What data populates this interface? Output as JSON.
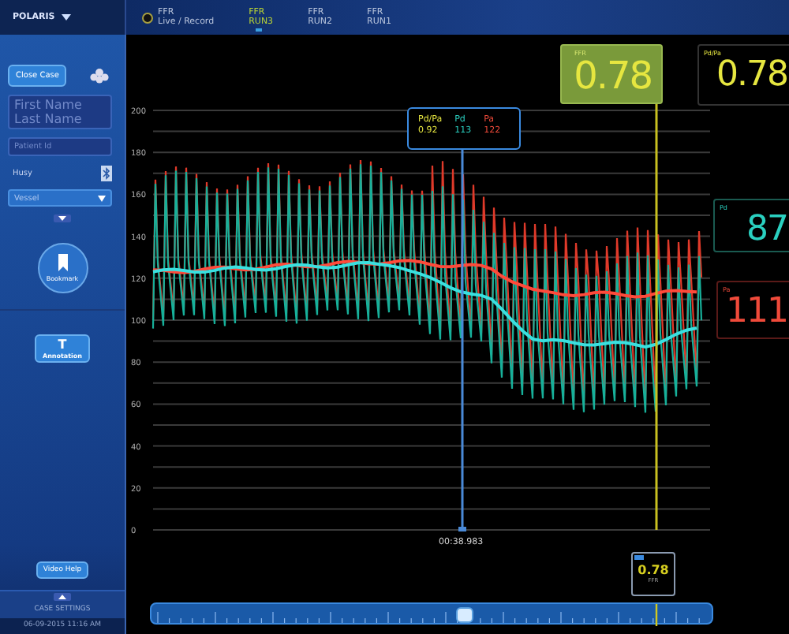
{
  "header": {
    "system": "POLARIS",
    "tabs": [
      {
        "kind": "live",
        "line1": "FFR",
        "line2": "Live / Record",
        "selected": false
      },
      {
        "kind": "run",
        "line1": "FFR",
        "line2": "RUN3",
        "selected": true
      },
      {
        "kind": "run",
        "line1": "FFR",
        "line2": "RUN2",
        "selected": false
      },
      {
        "kind": "run",
        "line1": "FFR",
        "line2": "RUN1",
        "selected": false
      }
    ]
  },
  "sidebar": {
    "close_case": "Close Case",
    "name_field": {
      "placeholder": "First Name\nLast Name"
    },
    "patient_id": {
      "placeholder": "Patient Id"
    },
    "physician": {
      "value": "Husy"
    },
    "vessel": {
      "placeholder": "Vessel"
    },
    "details_toggle": {
      "expanded": false
    },
    "settings_toggle": {
      "expanded": false
    },
    "bookmark": "Bookmark",
    "annotation_glyph": "T",
    "annotation": "Annotation",
    "video_help": "Video Help",
    "case_settings": "CASE SETTINGS",
    "datetime": "06-09-2015 11:16 AM"
  },
  "chart": {
    "y_labels": [
      "200",
      "180",
      "160",
      "140",
      "120",
      "100",
      "80",
      "60",
      "40",
      "20",
      "0"
    ],
    "cursor": {
      "time": "00:38.983",
      "items": [
        {
          "kind": "pdpa",
          "label": "Pd/Pa",
          "value": "0.92"
        },
        {
          "kind": "pd",
          "label": "Pd",
          "value": "113"
        },
        {
          "kind": "pa",
          "label": "Pa",
          "value": "122"
        }
      ]
    }
  },
  "readouts": [
    {
      "kind": "ffr",
      "label": "FFR",
      "value": "0.78"
    },
    {
      "kind": "pdpa",
      "label": "Pd/Pa",
      "value": "0.78"
    },
    {
      "kind": "pd",
      "label": "Pd",
      "value": "87"
    },
    {
      "kind": "pa",
      "label": "Pa",
      "value": "111"
    }
  ],
  "marker": {
    "value": "0.78",
    "label": "FFR"
  }
}
